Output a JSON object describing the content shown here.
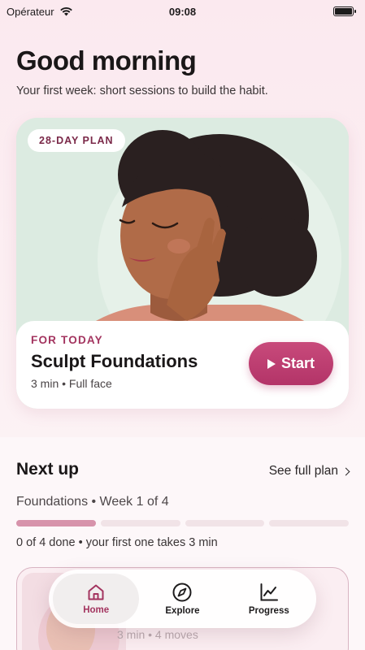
{
  "status": {
    "carrier": "Opérateur",
    "time": "09:08"
  },
  "greeting": {
    "title": "Good morning",
    "subtitle": "Your first week: short sessions to build the habit."
  },
  "hero": {
    "badge": "28-DAY PLAN",
    "kicker": "FOR TODAY",
    "title": "Sculpt Foundations",
    "meta": "3 min • Full face",
    "start_label": "Start"
  },
  "next_up": {
    "heading": "Next up",
    "see_plan": "See full plan",
    "week_label": "Foundations • Week 1 of 4",
    "segments_total": 4,
    "segments_active": 1,
    "done_text": "0 of 4 done • your first one takes 3 min",
    "peek_meta": "3 min • 4 moves"
  },
  "tabs": [
    {
      "label": "Home",
      "icon": "home-icon",
      "active": true
    },
    {
      "label": "Explore",
      "icon": "compass-icon",
      "active": false
    },
    {
      "label": "Progress",
      "icon": "chart-icon",
      "active": false
    }
  ],
  "colors": {
    "accent": "#b33468",
    "accent_text": "#a3345f",
    "progress_active": "#d793ab",
    "hero_bg": "#dcebe1"
  }
}
